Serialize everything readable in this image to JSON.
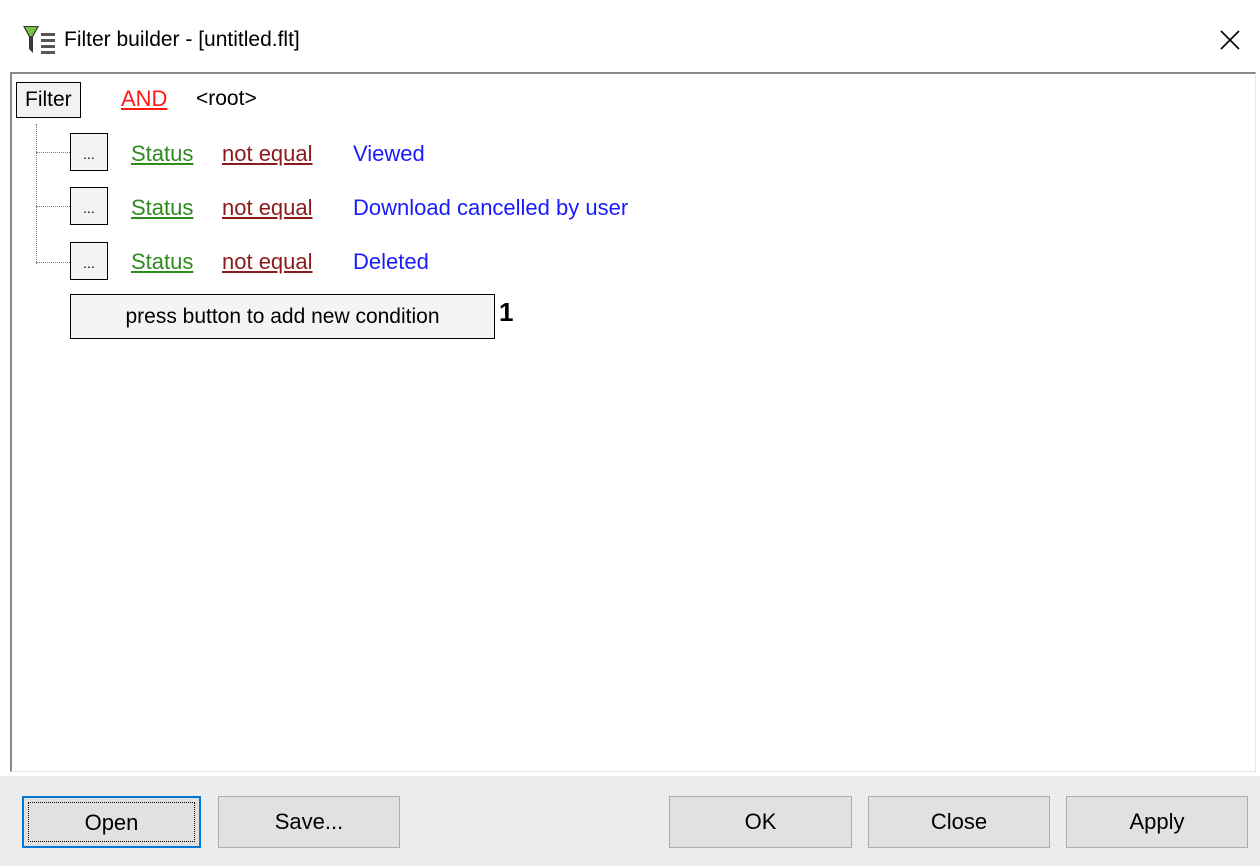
{
  "window": {
    "title": "Filter builder - [untitled.flt]",
    "app_icon": "filter-builder-icon",
    "close_icon": "close-icon"
  },
  "filter": {
    "root_button_label": "Filter",
    "root_operator": "AND",
    "root_label": "<root>",
    "conditions": [
      {
        "button_label": "...",
        "field": "Status",
        "operator": "not equal",
        "value": "Viewed"
      },
      {
        "button_label": "...",
        "field": "Status",
        "operator": "not equal",
        "value": "Download cancelled by user"
      },
      {
        "button_label": "...",
        "field": "Status",
        "operator": "not equal",
        "value": "Deleted"
      }
    ],
    "add_condition_label": "press button to add new condition",
    "callout_marker": "1"
  },
  "buttons": {
    "open": "Open",
    "save": "Save...",
    "ok": "OK",
    "close": "Close",
    "apply": "Apply"
  },
  "colors": {
    "operator_and": "#ff1a1a",
    "field": "#2e8b1e",
    "comparison": "#8b1a1a",
    "value": "#1a1aff",
    "default_button_border": "#0078d7"
  }
}
